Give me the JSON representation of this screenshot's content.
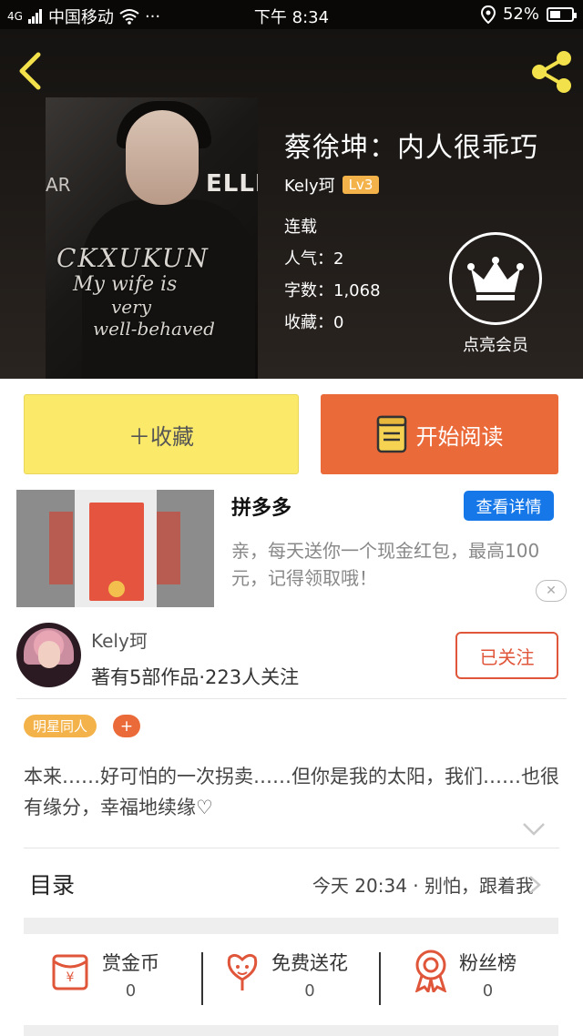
{
  "status_bar": {
    "network": "4G",
    "carrier": "中国移动",
    "dots": "···",
    "time": "下午 8:34",
    "battery": "52%",
    "battery_level": 0.52
  },
  "book": {
    "title": "蔡徐坤：内人很乖巧",
    "author": "Kely珂",
    "level": "Lv3",
    "status": "连载",
    "popularity": "人气：2",
    "word_count": "字数：1,068",
    "favorites": "收藏：0",
    "cover": {
      "text_line1": "CKXUKUN",
      "text_line2": "My wife is",
      "text_line3": "very",
      "text_line4": "well-behaved",
      "brand": "ELLEMI",
      "brand2": "AR"
    }
  },
  "vip": {
    "label": "点亮会员"
  },
  "actions": {
    "collect": "＋收藏",
    "read": "开始阅读"
  },
  "ad": {
    "title": "拼多多",
    "button": "查看详情",
    "description": "亲，每天送你一个现金红包，最高100元，记得领取哦！",
    "close": "✕"
  },
  "author_card": {
    "name": "Kely珂",
    "stats": "著有5部作品·223人关注",
    "follow": "已关注"
  },
  "tags": [
    "明星同人"
  ],
  "tag_add": "+",
  "synopsis": "本来……好可怕的一次拐卖……但你是我的太阳，我们……也很有缘分，幸福地续缘♡",
  "toc": {
    "label": "目录",
    "latest": "今天 20:34 · 别怕，跟着我"
  },
  "rewards": [
    {
      "label": "赏金币",
      "count": "0",
      "icon": "red-envelope-icon"
    },
    {
      "label": "免费送花",
      "count": "0",
      "icon": "flower-icon"
    },
    {
      "label": "粉丝榜",
      "count": "0",
      "icon": "medal-icon"
    }
  ],
  "colors": {
    "accent_orange": "#ea6a3a",
    "collect_yellow": "#fbe96a",
    "level_badge": "#f4b34a",
    "ad_button_blue": "#1677e8",
    "share_icon_yellow": "#f2e14a"
  }
}
